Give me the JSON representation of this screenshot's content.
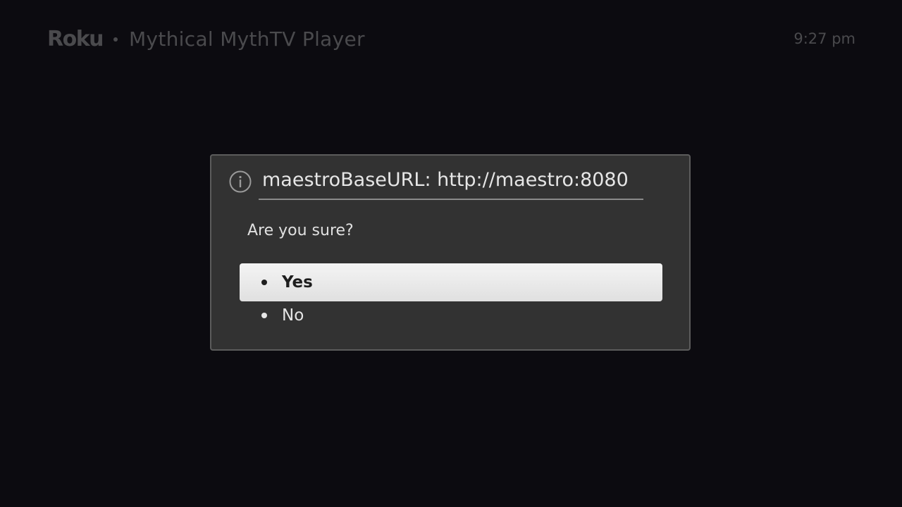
{
  "header": {
    "logo": "Roku",
    "app_title": "Mythical MythTV Player",
    "clock": "9:27 pm"
  },
  "dialog": {
    "icon": "info-icon",
    "title": "maestroBaseURL: http://maestro:8080",
    "message": "Are you sure?",
    "options": [
      {
        "label": "Yes",
        "selected": true
      },
      {
        "label": "No",
        "selected": false
      }
    ]
  },
  "colors": {
    "background": "#0c0b10",
    "dialog_background": "#323232",
    "dialog_border": "#5c5c5c",
    "header_text": "#4a4a4d",
    "selection_highlight": "#eeeeee"
  }
}
